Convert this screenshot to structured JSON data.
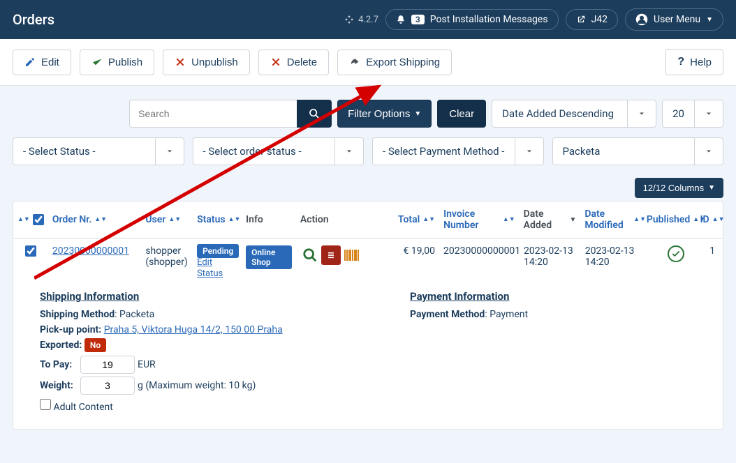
{
  "header": {
    "title": "Orders",
    "version": "4.2.7",
    "noti_count": "3",
    "noti_label": "Post Installation Messages",
    "site": "J42",
    "user_menu": "User Menu"
  },
  "toolbar": {
    "edit": "Edit",
    "publish": "Publish",
    "unpublish": "Unpublish",
    "delete": "Delete",
    "export": "Export Shipping",
    "help": "Help"
  },
  "filters": {
    "search_placeholder": "Search",
    "filter_options": "Filter Options",
    "clear": "Clear",
    "sort": "Date Added Descending",
    "limit": "20",
    "status": "- Select Status -",
    "order_status": "- Select order status -",
    "payment_method": "- Select Payment Method -",
    "shipping_method": "Packeta",
    "columns_label": "12/12 Columns"
  },
  "cols": {
    "order": "Order Nr.",
    "user": "User",
    "status": "Status",
    "info": "Info",
    "action": "Action",
    "total": "Total",
    "invoice": "Invoice Number",
    "added": "Date Added",
    "modified": "Date Modified",
    "published": "Published",
    "id": "ID"
  },
  "row": {
    "order_nr": "20230000000001",
    "user_name": "shopper",
    "user_login": "(shopper)",
    "status": "Pending",
    "edit_status": "Edit Status",
    "info": "Online Shop",
    "total": "€ 19,00",
    "invoice": "20230000000001",
    "added": "2023-02-13 14:20",
    "modified": "2023-02-13 14:20",
    "id": "1"
  },
  "detail": {
    "ship_title": "Shipping Information",
    "ship_method_label": "Shipping Method",
    "ship_method_value": "Packeta",
    "pickup_label": "Pick-up point:",
    "pickup_value": "Praha 5, Viktora Huga 14/2, 150 00 Praha",
    "exported_label": "Exported:",
    "exported_value": "No",
    "topay_label": "To Pay:",
    "topay_value": "19",
    "topay_unit": "EUR",
    "weight_label": "Weight:",
    "weight_value": "3",
    "weight_unit": "g (Maximum weight: 10 kg)",
    "adult_label": "Adult Content",
    "pay_title": "Payment Information",
    "pay_method_label": "Payment Method",
    "pay_method_value": "Payment"
  }
}
